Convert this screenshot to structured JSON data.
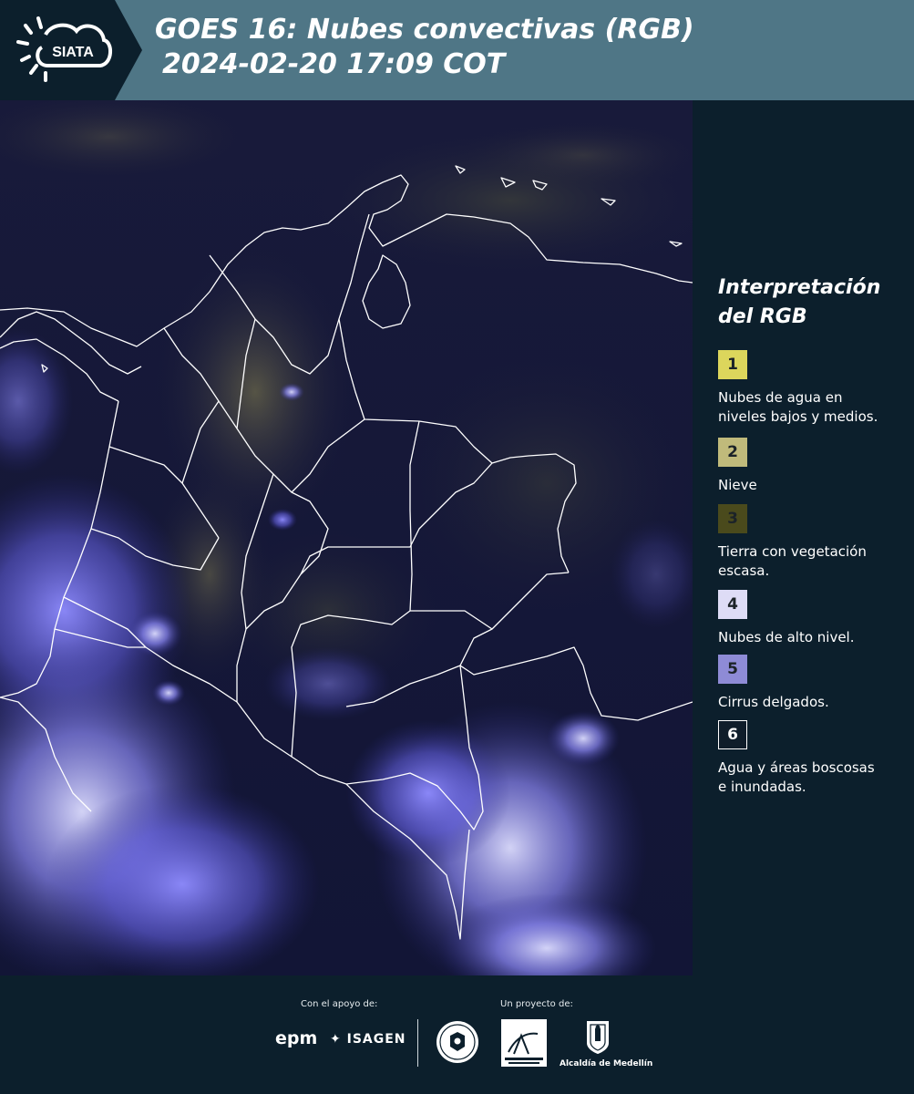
{
  "header": {
    "logo_text": "SIATA",
    "title_line1": "GOES 16: Nubes convectivas (RGB)",
    "title_line2": "2024-02-20 17:09 COT",
    "background": "#4f7686"
  },
  "legend": {
    "title_line1": "Interpretación",
    "title_line2": "del RGB",
    "items": [
      {
        "number": "1",
        "color": "#dcd65c",
        "label_line1": "Nubes de agua en",
        "label_line2": "niveles bajos y medios."
      },
      {
        "number": "2",
        "color": "#c0ba7b",
        "label_line1": "Nieve",
        "label_line2": ""
      },
      {
        "number": "3",
        "color": "#4a4a1c",
        "label_line1": "Tierra con vegetación",
        "label_line2": "escasa."
      },
      {
        "number": "4",
        "color": "#dedcf6",
        "label_line1": "Nubes de alto nivel.",
        "label_line2": ""
      },
      {
        "number": "5",
        "color": "#8e8bd6",
        "label_line1": "Cirrus delgados.",
        "label_line2": ""
      },
      {
        "number": "6",
        "color": "#0f1d2a",
        "label_line1": "Agua y áreas boscosas",
        "label_line2": "e inundadas."
      }
    ]
  },
  "footer": {
    "support_label": "Con el apoyo de:",
    "project_label": "Un proyecto de:",
    "sponsor_epm": "epm",
    "sponsor_isagen": "ISAGEN",
    "partner_alcaldia": "Alcaldía de Medellín"
  },
  "colors": {
    "background": "#0c1f2c",
    "map_background": "#13163a",
    "cloud_blue": "#6b68f0",
    "border_lines": "#ffffff"
  }
}
